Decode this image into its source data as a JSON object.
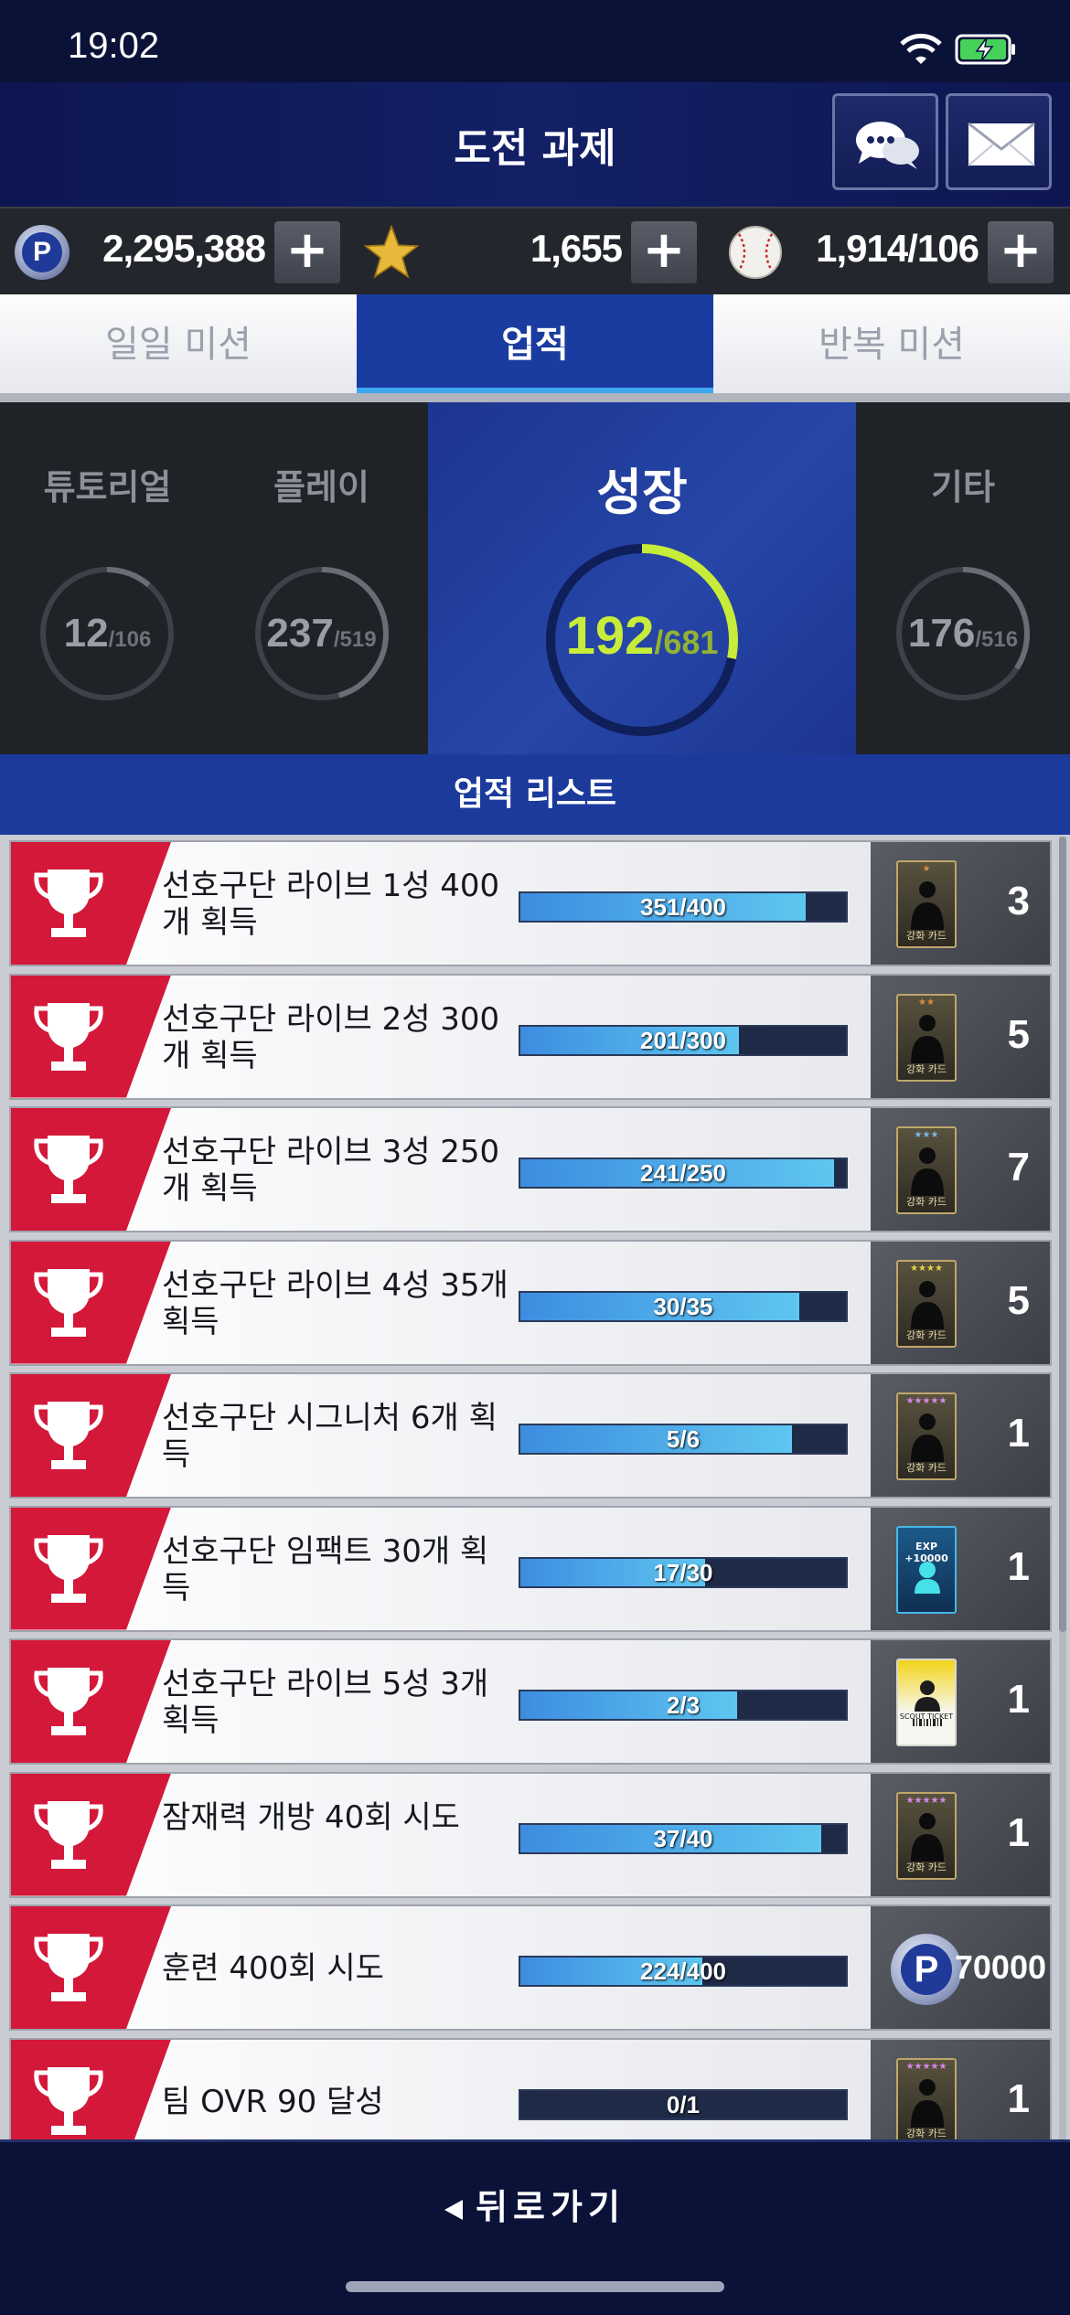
{
  "status": {
    "time": "19:02"
  },
  "header": {
    "title": "도전 과제"
  },
  "currency": [
    {
      "icon": "p-coin-icon",
      "value": "2,295,388"
    },
    {
      "icon": "star-icon",
      "value": "1,655"
    },
    {
      "icon": "baseball-icon",
      "value": "1,914/106"
    }
  ],
  "tabs": [
    "일일 미션",
    "업적",
    "반복 미션"
  ],
  "categories": [
    {
      "label": "튜토리얼",
      "current": "12",
      "total": "/106",
      "progress": 0.113
    },
    {
      "label": "플레이",
      "current": "237",
      "total": "/519",
      "progress": 0.457
    },
    {
      "label": "성장",
      "current": "192",
      "total": "/681",
      "progress": 0.282
    },
    {
      "label": "기타",
      "current": "176",
      "total": "/516",
      "progress": 0.341
    }
  ],
  "list_header": "업적 리스트",
  "achievements": [
    {
      "name": "선호구단 라이브 1성 400개 획득",
      "progress": "351/400",
      "fraction": 0.8775,
      "reward_type": "card",
      "card_stars": "★",
      "card_caption": "강화 카드",
      "reward_qty": "3"
    },
    {
      "name": "선호구단 라이브 2성 300개 획득",
      "progress": "201/300",
      "fraction": 0.67,
      "reward_type": "card",
      "card_stars": "★★",
      "card_caption": "강화 카드",
      "reward_qty": "5"
    },
    {
      "name": "선호구단 라이브 3성 250개 획득",
      "progress": "241/250",
      "fraction": 0.964,
      "reward_type": "card",
      "card_stars": "★★★",
      "card_caption": "강화 카드",
      "reward_qty": "7"
    },
    {
      "name": "선호구단 라이브 4성 35개 획득",
      "progress": "30/35",
      "fraction": 0.857,
      "reward_type": "card",
      "card_stars": "★★★★",
      "card_caption": "강화 카드",
      "reward_qty": "5"
    },
    {
      "name": "선호구단 시그니처 6개 획득",
      "progress": "5/6",
      "fraction": 0.833,
      "reward_type": "card",
      "card_stars": "★★★★★",
      "card_caption": "강화 카드",
      "reward_qty": "1"
    },
    {
      "name": "선호구단 임팩트 30개 획득",
      "progress": "17/30",
      "fraction": 0.567,
      "reward_type": "exp",
      "card_caption": "EXP +10000",
      "reward_qty": "1"
    },
    {
      "name": "선호구단 라이브 5성 3개 획득",
      "progress": "2/3",
      "fraction": 0.667,
      "reward_type": "ticket",
      "card_caption": "SCOUT TICKET",
      "reward_qty": "1"
    },
    {
      "name": "잠재력 개방 40회 시도",
      "progress": "37/40",
      "fraction": 0.925,
      "reward_type": "card",
      "card_stars": "★★★★★",
      "card_caption": "강화 카드",
      "reward_qty": "1"
    },
    {
      "name": "훈련 400회 시도",
      "progress": "224/400",
      "fraction": 0.56,
      "reward_type": "coin",
      "reward_qty": "70000"
    },
    {
      "name": "팀 OVR 90 달성",
      "progress": "0/1",
      "fraction": 0.0,
      "reward_type": "card",
      "card_stars": "★★★★★",
      "card_caption": "강화 카드",
      "reward_qty": "1"
    }
  ],
  "footer": {
    "back_label": "뒤로가기"
  }
}
